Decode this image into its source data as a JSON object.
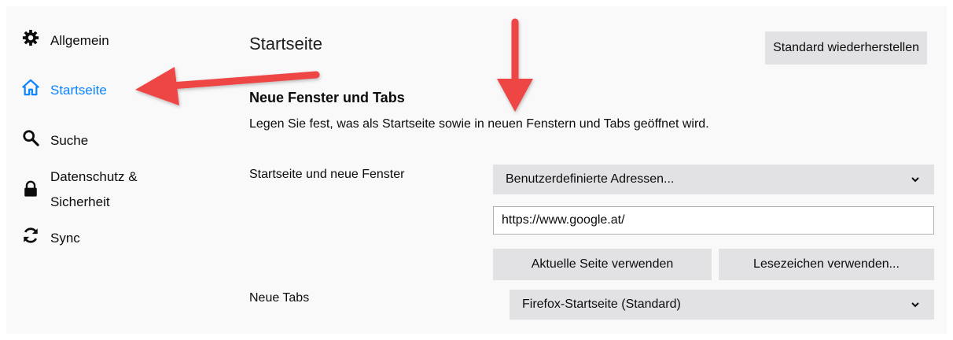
{
  "sidebar": {
    "items": [
      {
        "label": "Allgemein",
        "icon": "gear-icon"
      },
      {
        "label": "Startseite",
        "icon": "home-icon",
        "selected": true
      },
      {
        "label": "Suche",
        "icon": "search-icon"
      },
      {
        "label": "Datenschutz & Sicherheit",
        "icon": "lock-icon"
      },
      {
        "label": "Sync",
        "icon": "sync-icon"
      }
    ]
  },
  "main": {
    "title": "Startseite",
    "restore_button": "Standard wiederherstellen",
    "section_heading": "Neue Fenster und Tabs",
    "section_description": "Legen Sie fest, was als Startseite sowie in neuen Fenstern und Tabs geöffnet wird.",
    "homepage": {
      "label": "Startseite und neue Fenster",
      "selected": "Benutzerdefinierte Adressen...",
      "url_value": "https://www.google.at/",
      "use_current_button": "Aktuelle Seite verwenden",
      "use_bookmark_button": "Lesezeichen verwenden..."
    },
    "newtabs": {
      "label": "Neue Tabs",
      "selected": "Firefox-Startseite (Standard)"
    }
  },
  "colors": {
    "accent": "#0a84ff",
    "annotation_arrow": "#ee4444",
    "button_bg": "#e2e2e4",
    "page_bg": "#f9f9fa"
  }
}
